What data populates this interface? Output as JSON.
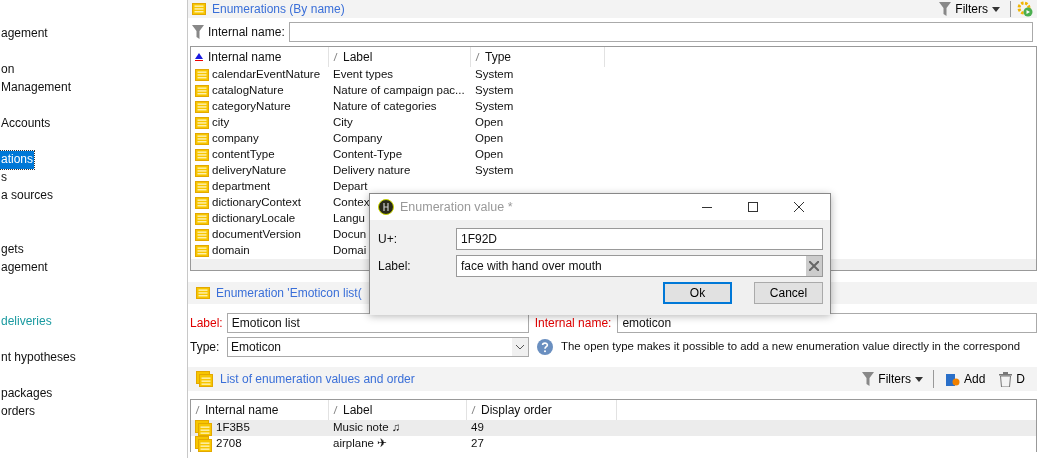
{
  "sidebar": {
    "items": [
      {
        "label": "agement",
        "selected": false,
        "kind": "plain"
      },
      {
        "label": "on",
        "selected": false,
        "kind": "plain"
      },
      {
        "label": "Management",
        "selected": false,
        "kind": "plain"
      },
      {
        "label": "Accounts",
        "selected": false,
        "kind": "plain"
      },
      {
        "label": "ations",
        "selected": true,
        "kind": "plain"
      },
      {
        "label": "s",
        "selected": false,
        "kind": "plain"
      },
      {
        "label": "a sources",
        "selected": false,
        "kind": "plain"
      },
      {
        "label": "gets",
        "selected": false,
        "kind": "plain"
      },
      {
        "label": "agement",
        "selected": false,
        "kind": "plain"
      },
      {
        "label": "deliveries",
        "selected": false,
        "kind": "link"
      },
      {
        "label": "nt hypotheses",
        "selected": false,
        "kind": "plain"
      },
      {
        "label": "packages",
        "selected": false,
        "kind": "plain"
      },
      {
        "label": "orders",
        "selected": false,
        "kind": "plain"
      }
    ]
  },
  "list_panel": {
    "title": "Enumerations (By name)",
    "filters_button": "Filters",
    "filter": {
      "label": "Internal name:"
    },
    "columns": [
      {
        "label": "Internal name",
        "sorted": true
      },
      {
        "label": "Label",
        "sorted": false
      },
      {
        "label": "Type",
        "sorted": false
      }
    ],
    "rows": [
      {
        "internal_name": "calendarEventNature",
        "label": "Event types",
        "type": "System"
      },
      {
        "internal_name": "catalogNature",
        "label": "Nature of campaign pac...",
        "type": "System"
      },
      {
        "internal_name": "categoryNature",
        "label": "Nature of categories",
        "type": "System"
      },
      {
        "internal_name": "city",
        "label": "City",
        "type": "Open"
      },
      {
        "internal_name": "company",
        "label": "Company",
        "type": "Open"
      },
      {
        "internal_name": "contentType",
        "label": "Content-Type",
        "type": "Open"
      },
      {
        "internal_name": "deliveryNature",
        "label": "Delivery nature",
        "type": "System"
      },
      {
        "internal_name": "department",
        "label": "Depart"
      },
      {
        "internal_name": "dictionaryContext",
        "label": "Contex"
      },
      {
        "internal_name": "dictionaryLocale",
        "label": "Langu"
      },
      {
        "internal_name": "documentVersion",
        "label": "Docun"
      },
      {
        "internal_name": "domain",
        "label": "Domai"
      }
    ]
  },
  "detail": {
    "title": "Enumeration 'Emoticon list(",
    "fields": [
      {
        "label": "Label:",
        "value": "Emoticon list",
        "required": true,
        "kind": "text"
      },
      {
        "label": "Internal name:",
        "value": "emoticon",
        "required": true,
        "kind": "text"
      },
      {
        "label": "Type:",
        "value": "Emoticon",
        "required": false,
        "kind": "select"
      }
    ],
    "help": "The open type makes it possible to add a new enumeration value directly in the correspond",
    "values": {
      "title": "List of enumeration values and order",
      "toolbar": [
        "Filters",
        "Add",
        "D"
      ],
      "columns": [
        {
          "label": "Internal name",
          "sorted": false
        },
        {
          "label": "Label",
          "sorted": false
        },
        {
          "label": "Display order",
          "sorted": false
        }
      ],
      "rows": [
        {
          "internal_name": "1F3B5",
          "label": "Music note ♫",
          "order": "49",
          "selected": true
        },
        {
          "internal_name": "2708",
          "label": "airplane ✈",
          "order": "27",
          "selected": false
        }
      ]
    }
  },
  "dialog": {
    "title": "Enumeration value *",
    "fields": [
      {
        "label": "U+:",
        "value": "1F92D",
        "clearable": false
      },
      {
        "label": "Label:",
        "value": "face with hand over mouth",
        "clearable": true
      }
    ],
    "buttons": [
      {
        "label": "Ok",
        "default": true
      },
      {
        "label": "Cancel",
        "default": false
      }
    ]
  }
}
